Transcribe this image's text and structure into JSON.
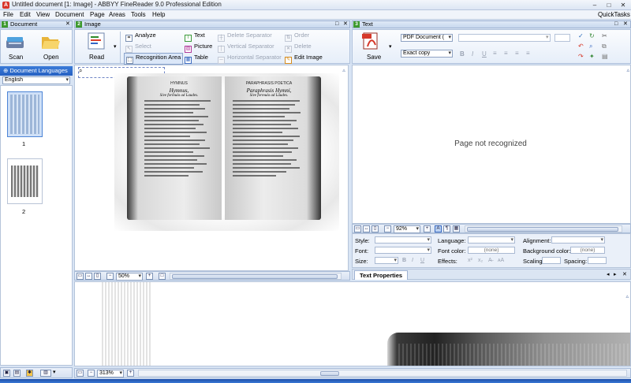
{
  "window": {
    "title": "Untitled document [1: Image] - ABBYY FineReader 9.0 Professional Edition",
    "min": "–",
    "max": "□",
    "close": "✕"
  },
  "menu": {
    "items": [
      "File",
      "Edit",
      "View",
      "Document",
      "Page",
      "Areas",
      "Tools",
      "Help"
    ],
    "quicktasks": "QuickTasks"
  },
  "document_panel": {
    "num": "1",
    "title": "Document",
    "scan_label": "Scan",
    "open_label": "Open",
    "languages_label": "Document Languages",
    "language_value": "English",
    "pages": [
      "1",
      "2"
    ]
  },
  "image_panel": {
    "num": "2",
    "title": "Image",
    "read_label": "Read",
    "analyze": "Analyze",
    "select": "Select",
    "recognition_area": "Recognition Area",
    "text": "Text",
    "picture": "Picture",
    "table": "Table",
    "delete_separator": "Delete Separator",
    "vertical_separator": "Vertical Separator",
    "horizontal_separator": "Horizontal Separator",
    "order": "Order",
    "delete": "Delete",
    "edit_image": "Edit Image",
    "zoom": "50%",
    "zoom_bottom": "313%"
  },
  "book": {
    "left_header": "HYMNUS",
    "left_title": "Hymnus,",
    "left_subtitle": "Sive formula ad Laudes.",
    "right_header": "PARAPHRASIS POETICA",
    "right_title": "Paraphrasis Hymni,",
    "right_subtitle": "Sive formula ad Laudes."
  },
  "text_panel": {
    "num": "3",
    "title": "Text",
    "save_label": "Save",
    "format_value": "PDF Document (",
    "copy_mode": "Exact copy",
    "page_status": "Page not recognized",
    "zoom": "92%",
    "properties_tab": "Text Properties"
  },
  "properties": {
    "style": "Style:",
    "font": "Font:",
    "size": "Size:",
    "language": "Language:",
    "font_color": "Font color:",
    "effects": "Effects:",
    "font_color_value": "(none)",
    "alignment": "Alignment:",
    "background_color": "Background color:",
    "background_color_value": "(none)",
    "scaling": "Scaling:",
    "spacing": "Spacing:"
  },
  "colors": {
    "accent": "#3e9a2f",
    "panel_header": "#c8d8ee",
    "window_bg": "#d8e4f4"
  }
}
